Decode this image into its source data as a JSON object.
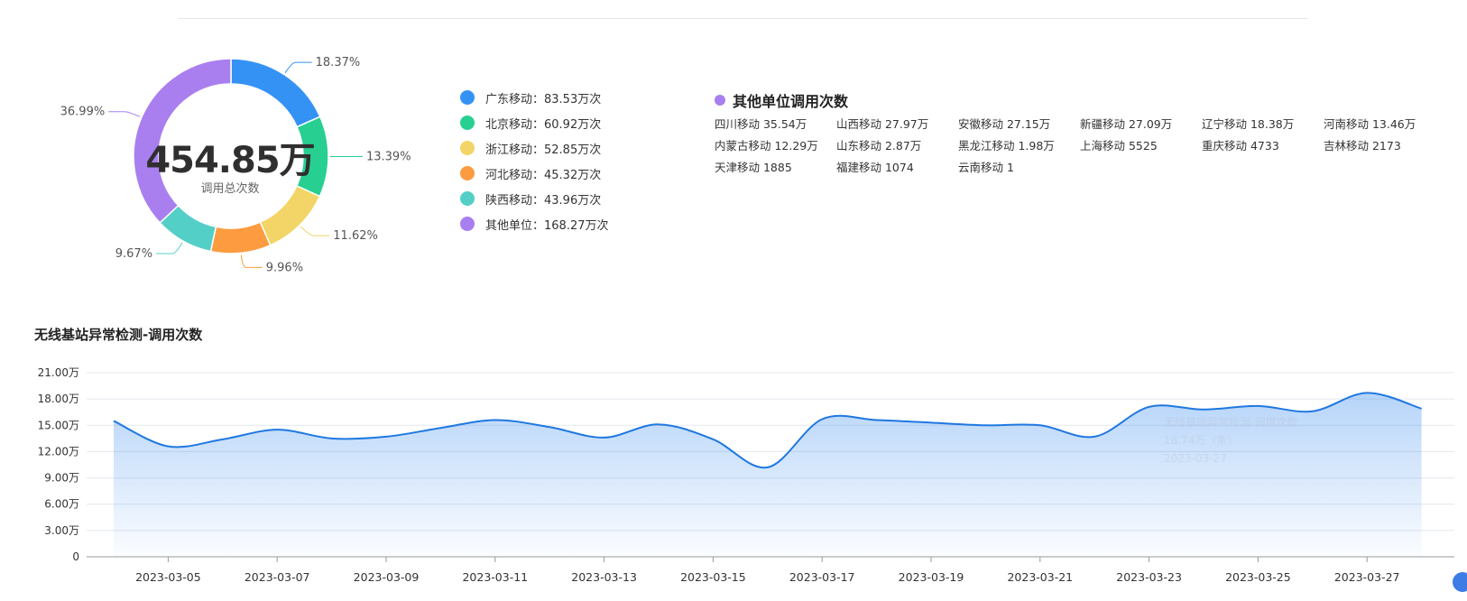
{
  "donut": {
    "total": "454.85万",
    "total_label": "调用总次数",
    "slices": [
      {
        "name": "广东移动",
        "value": "83.53万次",
        "percent": 18.37,
        "percent_label": "18.37%",
        "color": "#3592f5"
      },
      {
        "name": "北京移动",
        "value": "60.92万次",
        "percent": 13.39,
        "percent_label": "13.39%",
        "color": "#27cf91"
      },
      {
        "name": "浙江移动",
        "value": "52.85万次",
        "percent": 11.62,
        "percent_label": "11.62%",
        "color": "#f2d566"
      },
      {
        "name": "河北移动",
        "value": "45.32万次",
        "percent": 9.96,
        "percent_label": "9.96%",
        "color": "#fc9b40"
      },
      {
        "name": "陕西移动",
        "value": "43.96万次",
        "percent": 9.67,
        "percent_label": "9.67%",
        "color": "#54cfc7"
      },
      {
        "name": "其他单位",
        "value": "168.27万次",
        "percent": 36.99,
        "percent_label": "36.99%",
        "color": "#a97ff0"
      }
    ]
  },
  "others": {
    "title": "其他单位调用次数",
    "items": [
      "四川移动 35.54万",
      "山西移动 27.97万",
      "安徽移动 27.15万",
      "新疆移动 27.09万",
      "辽宁移动 18.38万",
      "河南移动 13.46万",
      "内蒙古移动 12.29万",
      "山东移动 2.87万",
      "黑龙江移动 1.98万",
      "上海移动 5525",
      "重庆移动 4733",
      "吉林移动 2173",
      "天津移动 1885",
      "福建移动 1074",
      "云南移动 1"
    ]
  },
  "chart_data": {
    "type": "area",
    "title": "无线基站异常检测-调用次数",
    "xlabel": "",
    "ylabel": "",
    "ylim": [
      0,
      210000
    ],
    "y_ticks": [
      "0",
      "3.00万",
      "6.00万",
      "9.00万",
      "12.00万",
      "15.00万",
      "18.00万",
      "21.00万"
    ],
    "x_tick_labels": [
      "2023-03-05",
      "2023-03-07",
      "2023-03-09",
      "2023-03-11",
      "2023-03-13",
      "2023-03-15",
      "2023-03-17",
      "2023-03-19",
      "2023-03-21",
      "2023-03-23",
      "2023-03-25",
      "2023-03-27"
    ],
    "x": [
      "2023-03-04",
      "2023-03-05",
      "2023-03-06",
      "2023-03-07",
      "2023-03-08",
      "2023-03-09",
      "2023-03-10",
      "2023-03-11",
      "2023-03-12",
      "2023-03-13",
      "2023-03-14",
      "2023-03-15",
      "2023-03-16",
      "2023-03-17",
      "2023-03-18",
      "2023-03-19",
      "2023-03-20",
      "2023-03-21",
      "2023-03-22",
      "2023-03-23",
      "2023-03-24",
      "2023-03-25",
      "2023-03-26",
      "2023-03-27",
      "2023-03-28"
    ],
    "series": [
      {
        "values": [
          155000,
          126000,
          134000,
          145000,
          135000,
          137000,
          147000,
          156000,
          148000,
          136000,
          151000,
          134000,
          102000,
          157000,
          156000,
          153000,
          150000,
          150000,
          137000,
          171000,
          168000,
          172000,
          166000,
          187000,
          169000
        ]
      }
    ],
    "line_color": "#1f78e0",
    "grid": true,
    "legend": "none"
  },
  "tooltip_ghost": {
    "line1": "无线基站异常检测-调用次数",
    "line2": "18.74万（条）",
    "line3": "2023-03-27"
  }
}
